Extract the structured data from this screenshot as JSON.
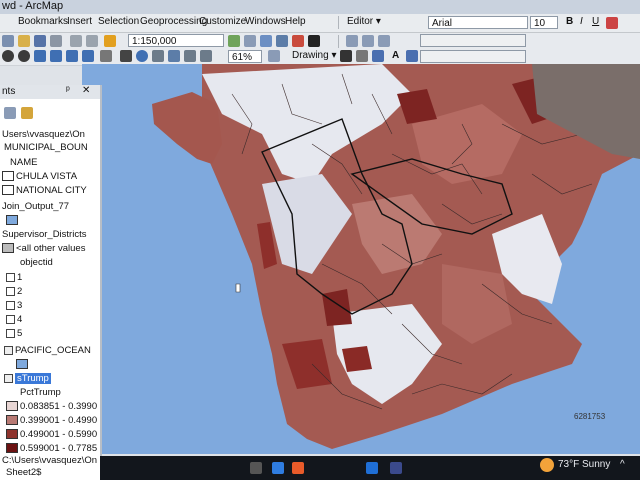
{
  "window": {
    "title": "wd - ArcMap"
  },
  "menu": [
    "Bookmarks",
    "Insert",
    "Selection",
    "Geoprocessing",
    "Customize",
    "Windows",
    "Help"
  ],
  "toolbar": {
    "editor_label": "Editor",
    "font_name": "Arial",
    "font_size": "10",
    "scale": "1:150,000",
    "drawing_label": "Drawing",
    "zoom": "61%"
  },
  "toc": {
    "panel_title": "nts",
    "items": [
      {
        "kind": "path",
        "text": "Users\\vvasquez\\On"
      },
      {
        "kind": "layer",
        "text": "MUNICIPAL_BOUN"
      },
      {
        "kind": "field",
        "text": "NAME"
      },
      {
        "kind": "symbol",
        "text": "CHULA VISTA"
      },
      {
        "kind": "symbol",
        "text": "NATIONAL CITY"
      },
      {
        "kind": "layer",
        "text": "Join_Output_77"
      },
      {
        "kind": "layer",
        "text": "Supervisor_Districts"
      },
      {
        "kind": "symbol",
        "text": "<all other values"
      },
      {
        "kind": "field",
        "text": "objectid"
      },
      {
        "kind": "class",
        "text": "1"
      },
      {
        "kind": "class",
        "text": "2"
      },
      {
        "kind": "class",
        "text": "3"
      },
      {
        "kind": "class",
        "text": "4"
      },
      {
        "kind": "class",
        "text": "5"
      },
      {
        "kind": "layer",
        "text": "PACIFIC_OCEAN"
      },
      {
        "kind": "layer",
        "text": "sTrump"
      },
      {
        "kind": "field",
        "text": "PctTrump"
      },
      {
        "kind": "class",
        "text": "0.083851 - 0.3990"
      },
      {
        "kind": "class",
        "text": "0.399001 - 0.4990"
      },
      {
        "kind": "class",
        "text": "0.499001 - 0.5990"
      },
      {
        "kind": "class",
        "text": "0.599001 - 0.7785"
      },
      {
        "kind": "path",
        "text": "C:\\Users\\vvasquez\\On"
      },
      {
        "kind": "layer",
        "text": "Sheet2$"
      }
    ]
  },
  "legend_colors": [
    "#e8d6d4",
    "#b87a74",
    "#8e332d",
    "#6b1212"
  ],
  "colors": {
    "ocean": "#7fa9dd",
    "land_base": "#a45a52",
    "light_tract": "#e6e8ef",
    "dark_tract": "#7d2422"
  },
  "status": {
    "coords": "6281753",
    "weather": "73°F  Sunny"
  }
}
